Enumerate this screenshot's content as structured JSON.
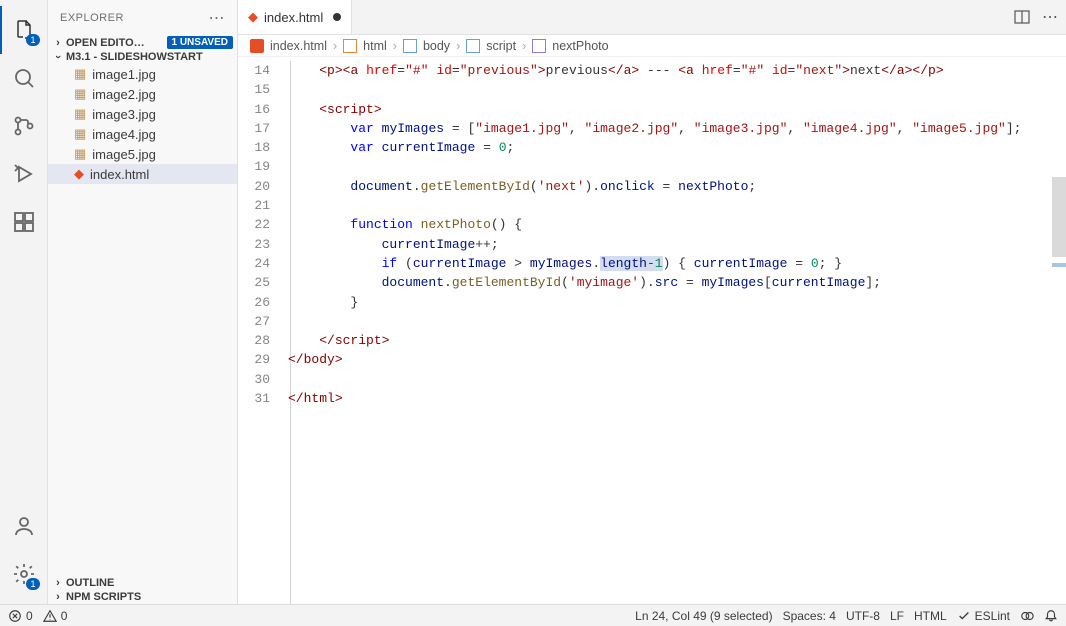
{
  "sidebar": {
    "title": "EXPLORER",
    "openEditors": {
      "label": "OPEN EDITO…",
      "badge": "1 UNSAVED"
    },
    "project": {
      "label": "M3.1 - SLIDESHOWSTART"
    },
    "files": [
      {
        "name": "image1.jpg",
        "type": "img"
      },
      {
        "name": "image2.jpg",
        "type": "img"
      },
      {
        "name": "image3.jpg",
        "type": "img"
      },
      {
        "name": "image4.jpg",
        "type": "img"
      },
      {
        "name": "image5.jpg",
        "type": "img"
      },
      {
        "name": "index.html",
        "type": "html",
        "active": true
      }
    ],
    "outline": "OUTLINE",
    "npm": "NPM SCRIPTS"
  },
  "tabs": {
    "active": "index.html"
  },
  "breadcrumb": {
    "file": "index.html",
    "parts": [
      "html",
      "body",
      "script",
      "nextPhoto"
    ]
  },
  "lineStart": 14,
  "lineEnd": 31,
  "status": {
    "errors": "0",
    "warnings": "0",
    "cursor": "Ln 24, Col 49 (9 selected)",
    "spaces": "Spaces: 4",
    "encoding": "UTF-8",
    "eol": "LF",
    "lang": "HTML",
    "lint": "ESLint"
  }
}
